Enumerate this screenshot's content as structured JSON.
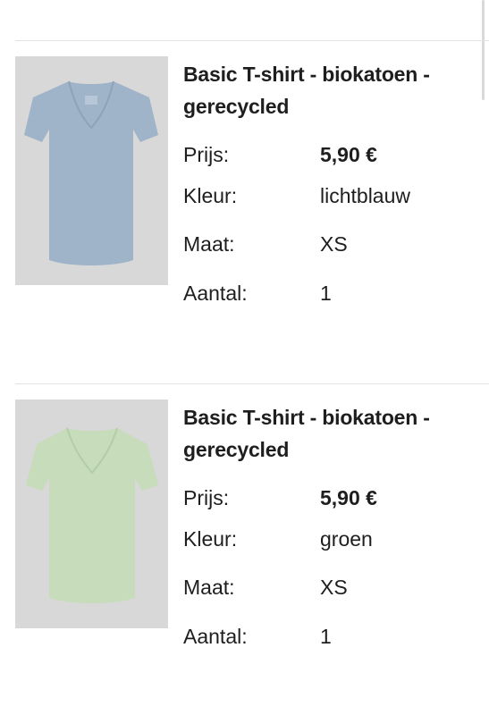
{
  "items": [
    {
      "title": "Basic T-shirt - biokatoen - gerecycled",
      "price_label": "Prijs:",
      "price": "5,90 €",
      "color_label": "Kleur:",
      "color": "lichtblauw",
      "size_label": "Maat:",
      "size": "XS",
      "qty_label": "Aantal:",
      "qty": "1",
      "shirt_color": "#9fb3c9",
      "image_bg": "#d8d8d8"
    },
    {
      "title": "Basic T-shirt - biokatoen - gerecycled",
      "price_label": "Prijs:",
      "price": "5,90 €",
      "color_label": "Kleur:",
      "color": "groen",
      "size_label": "Maat:",
      "size": "XS",
      "qty_label": "Aantal:",
      "qty": "1",
      "shirt_color": "#c6dcba",
      "image_bg": "#d8d8d8"
    }
  ]
}
